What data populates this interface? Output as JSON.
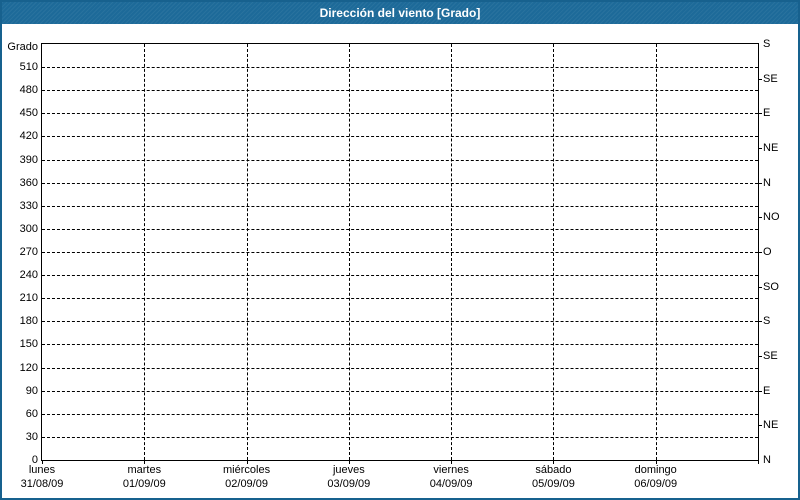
{
  "window": {
    "title": "Dirección del viento [Grado]"
  },
  "colors": {
    "titlebar_bg": "#1d6a99",
    "titlebar_text": "#ffffff",
    "window_border": "#17618e",
    "plot_border": "#000000",
    "grid": "#000000",
    "background": "#ffffff",
    "text": "#000000"
  },
  "chart_data": {
    "type": "line",
    "title": "Dirección del viento [Grado]",
    "ylabel": "Grado",
    "ylim": [
      0,
      540
    ],
    "grid": "dashed",
    "legend": "none",
    "y_ticks_left": [
      0,
      30,
      60,
      90,
      120,
      150,
      180,
      210,
      240,
      270,
      300,
      330,
      360,
      390,
      420,
      450,
      480,
      510
    ],
    "y_ticks_right": [
      {
        "deg": 0,
        "label": "N"
      },
      {
        "deg": 45,
        "label": "NE"
      },
      {
        "deg": 90,
        "label": "E"
      },
      {
        "deg": 135,
        "label": "SE"
      },
      {
        "deg": 180,
        "label": "S"
      },
      {
        "deg": 225,
        "label": "SO"
      },
      {
        "deg": 270,
        "label": "O"
      },
      {
        "deg": 315,
        "label": "NO"
      },
      {
        "deg": 360,
        "label": "N"
      },
      {
        "deg": 405,
        "label": "NE"
      },
      {
        "deg": 450,
        "label": "E"
      },
      {
        "deg": 495,
        "label": "SE"
      },
      {
        "deg": 540,
        "label": "S"
      }
    ],
    "x_categories": [
      {
        "day": "lunes",
        "date": "31/08/09"
      },
      {
        "day": "martes",
        "date": "01/09/09"
      },
      {
        "day": "miércoles",
        "date": "02/09/09"
      },
      {
        "day": "jueves",
        "date": "03/09/09"
      },
      {
        "day": "viernes",
        "date": "04/09/09"
      },
      {
        "day": "sábado",
        "date": "05/09/09"
      },
      {
        "day": "domingo",
        "date": "06/09/09"
      }
    ],
    "series": []
  }
}
